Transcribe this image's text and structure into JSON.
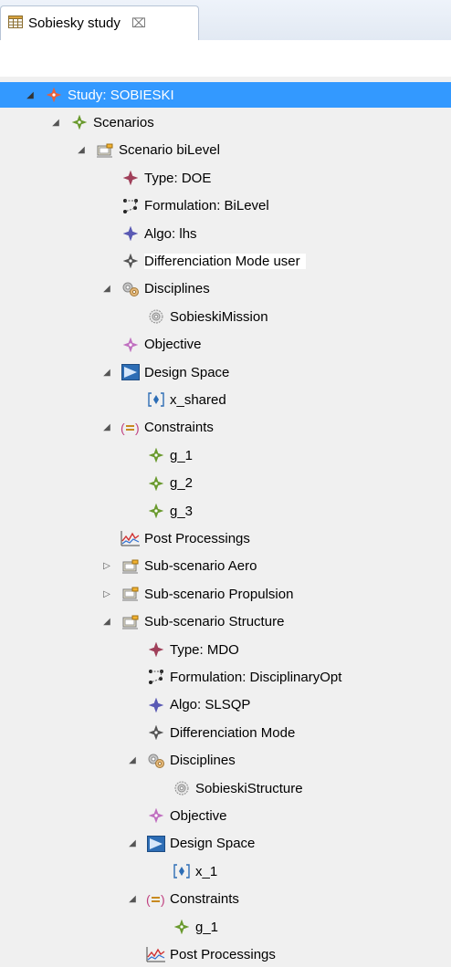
{
  "tab": {
    "title": "Sobiesky study",
    "close_glyph": "⌧"
  },
  "tree": {
    "twisty_expanded": "◢",
    "twisty_collapsed": "▷",
    "items": [
      {
        "label": "Study: SOBIESKI",
        "icon": "study-star-icon",
        "expanded": true,
        "selected": true
      },
      {
        "label": "Scenarios",
        "icon": "scenarios-star-icon",
        "expanded": true
      },
      {
        "label": "Scenario biLevel",
        "icon": "scenario-icon",
        "expanded": true
      },
      {
        "label": "Type: DOE",
        "icon": "type-star-icon"
      },
      {
        "label": "Formulation: BiLevel",
        "icon": "formulation-icon"
      },
      {
        "label": "Algo: lhs",
        "icon": "algo-star-icon"
      },
      {
        "label": "Differenciation Mode user",
        "icon": "diff-mode-star-icon",
        "hover": true
      },
      {
        "label": "Disciplines",
        "icon": "disciplines-gears-icon",
        "expanded": true
      },
      {
        "label": "SobieskiMission",
        "icon": "discipline-gear-icon"
      },
      {
        "label": "Objective",
        "icon": "objective-star-icon"
      },
      {
        "label": "Design Space",
        "icon": "design-space-icon",
        "expanded": true
      },
      {
        "label": "x_shared",
        "icon": "design-variable-icon"
      },
      {
        "label": "Constraints",
        "icon": "constraints-icon",
        "expanded": true
      },
      {
        "label": "g_1",
        "icon": "constraint-star-icon"
      },
      {
        "label": "g_2",
        "icon": "constraint-star-icon"
      },
      {
        "label": "g_3",
        "icon": "constraint-star-icon"
      },
      {
        "label": "Post Processings",
        "icon": "post-processing-chart-icon"
      },
      {
        "label": "Sub-scenario Aero",
        "icon": "scenario-icon",
        "collapsed": true
      },
      {
        "label": "Sub-scenario Propulsion",
        "icon": "scenario-icon",
        "collapsed": true
      },
      {
        "label": "Sub-scenario Structure",
        "icon": "scenario-icon",
        "expanded": true
      },
      {
        "label": "Type: MDO",
        "icon": "type-star-icon"
      },
      {
        "label": "Formulation: DisciplinaryOpt",
        "icon": "formulation-icon"
      },
      {
        "label": "Algo: SLSQP",
        "icon": "algo-star-icon"
      },
      {
        "label": "Differenciation Mode",
        "icon": "diff-mode-star-icon"
      },
      {
        "label": "Disciplines",
        "icon": "disciplines-gears-icon",
        "expanded": true
      },
      {
        "label": "SobieskiStructure",
        "icon": "discipline-gear-icon"
      },
      {
        "label": "Objective",
        "icon": "objective-star-icon"
      },
      {
        "label": "Design Space",
        "icon": "design-space-icon",
        "expanded": true
      },
      {
        "label": "x_1",
        "icon": "design-variable-icon"
      },
      {
        "label": "Constraints",
        "icon": "constraints-icon",
        "expanded": true
      },
      {
        "label": "g_1",
        "icon": "constraint-star-icon"
      },
      {
        "label": "Post Processings",
        "icon": "post-processing-chart-icon"
      }
    ]
  },
  "colors": {
    "selection": "#3399ff",
    "study_star": "#e8603c",
    "green_star": "#6a9a2e",
    "type_star": "#a0405a",
    "algo_star": "#5a5ab4",
    "diff_star": "#555555",
    "objective_star": "#c070c0"
  }
}
